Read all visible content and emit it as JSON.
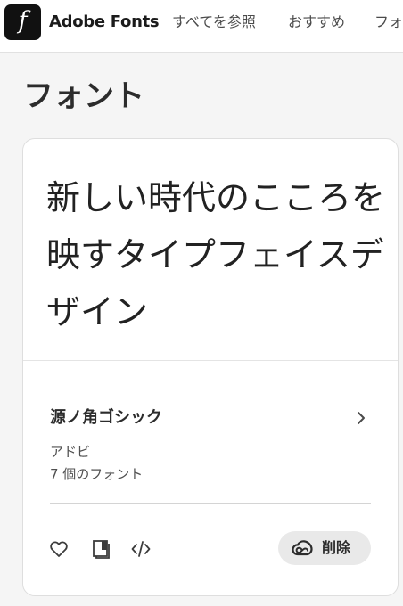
{
  "header": {
    "logo_glyph": "f",
    "brand": "Adobe Fonts",
    "nav": {
      "all": "すべてを参照",
      "recommended": "おすすめ",
      "truncated": "フォ"
    }
  },
  "page": {
    "title": "フォント"
  },
  "card": {
    "preview_text": "新しい時代のこころを映すタイプフェイスデザイン",
    "font_name": "源ノ角ゴシック",
    "foundry": "アドビ",
    "font_count": "7 個のフォント",
    "delete_label": "削除"
  },
  "icons": {
    "favorite": "heart-icon",
    "library": "book-icon",
    "embed": "code-icon",
    "detail": "chevron-right-icon",
    "creative_cloud": "creative-cloud-icon"
  },
  "colors": {
    "background": "#f5f5f5",
    "card": "#ffffff",
    "logo": "#111111",
    "button": "#e9e9e9",
    "text": "#2c2c2c"
  }
}
